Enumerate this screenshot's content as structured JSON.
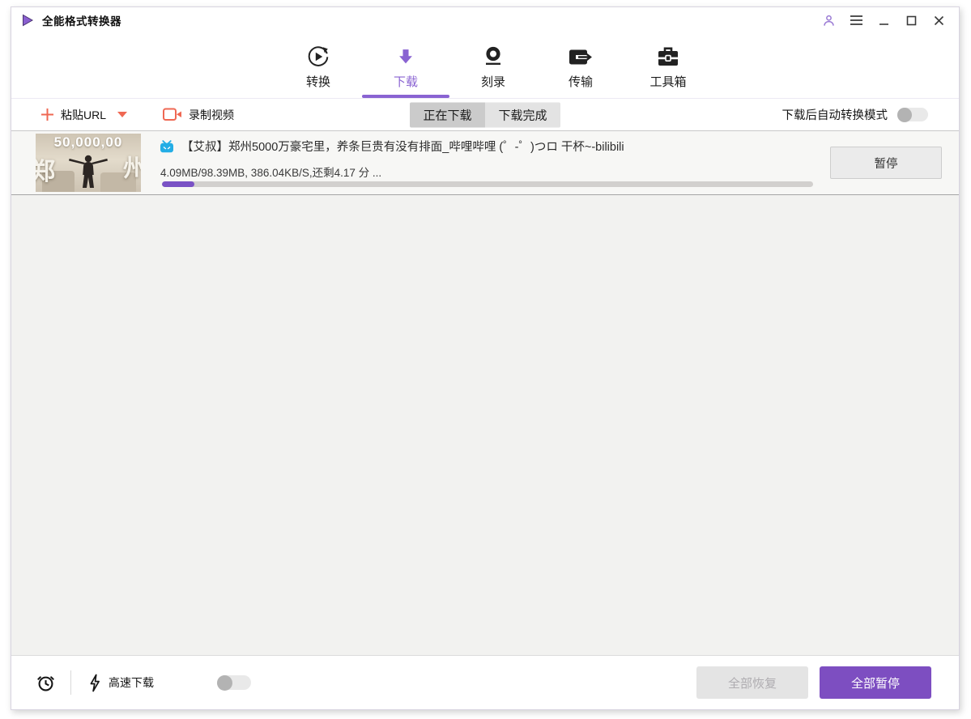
{
  "window": {
    "title": "全能格式转换器"
  },
  "nav": {
    "tabs": [
      {
        "label": "转换",
        "icon": "convert-icon",
        "active": false
      },
      {
        "label": "下载",
        "icon": "download-icon",
        "active": true
      },
      {
        "label": "刻录",
        "icon": "burn-icon",
        "active": false
      },
      {
        "label": "传输",
        "icon": "transfer-icon",
        "active": false
      },
      {
        "label": "工具箱",
        "icon": "toolbox-icon",
        "active": false
      }
    ]
  },
  "toolbar": {
    "paste_url_label": "粘贴URL",
    "record_video_label": "录制视频",
    "filter_tabs": [
      {
        "label": "正在下载",
        "active": true
      },
      {
        "label": "下载完成",
        "active": false
      }
    ],
    "auto_convert_label": "下载后自动转换模式",
    "auto_convert_enabled": false
  },
  "downloads": {
    "items": [
      {
        "source_icon": "bilibili-icon",
        "title": "【艾叔】郑州5000万豪宅里，养条巨贵有没有排面_哔哩哔哩 (゜-゜)つロ 干杯~-bilibili",
        "stats": "4.09MB/98.39MB, 386.04KB/S,还剩4.17 分 ...",
        "progress_percent": 5,
        "action_label": "暂停",
        "thumbnail": {
          "overlay_top": "50,000,00",
          "overlay_left": "郑",
          "overlay_right": "州"
        }
      }
    ]
  },
  "footer": {
    "speed_label": "高速下载",
    "speed_enabled": false,
    "resume_all_label": "全部恢复",
    "pause_all_label": "全部暂停"
  },
  "colors": {
    "accent_purple": "#8a63d2",
    "button_purple": "#7d4ec1",
    "progress_purple": "#7a52c5",
    "coral": "#ef6853",
    "bilibili_blue": "#23ade5"
  }
}
